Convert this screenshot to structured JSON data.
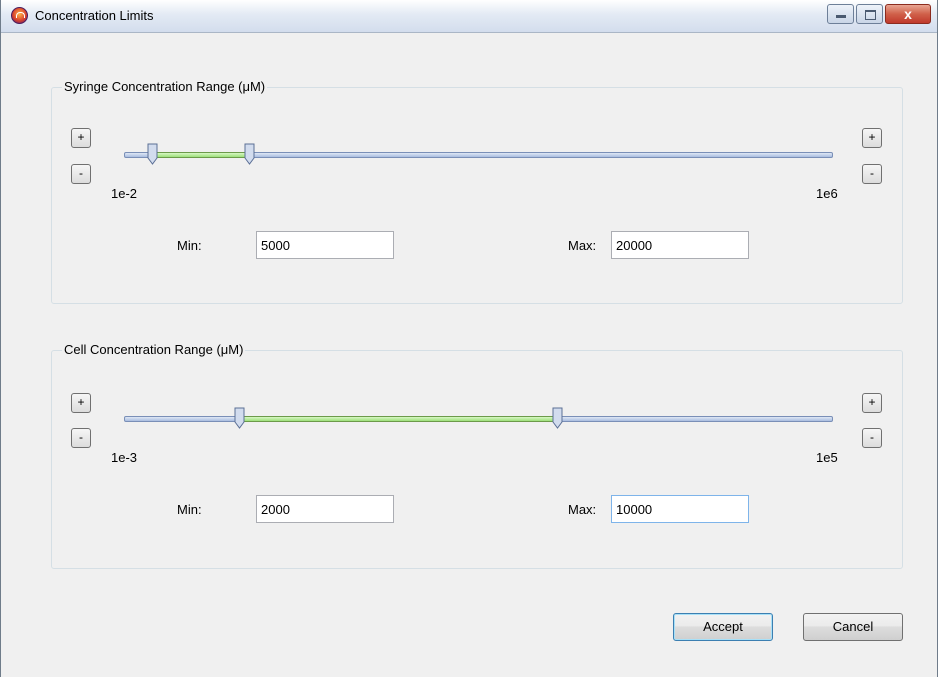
{
  "window": {
    "title": "Concentration Limits",
    "controls": [
      "minimize-icon",
      "maximize-icon",
      "close-icon"
    ],
    "close_glyph": "x"
  },
  "syringe": {
    "title": "Syringe Concentration Range (μM)",
    "increment_label": "+",
    "decrement_label": "-",
    "scale_min": "1e-2",
    "scale_max": "1e6",
    "min_label": "Min:",
    "max_label": "Max:",
    "min_value": "5000",
    "max_value": "20000"
  },
  "cell": {
    "title": "Cell Concentration Range (μM)",
    "increment_label": "+",
    "decrement_label": "-",
    "scale_min": "1e-3",
    "scale_max": "1e5",
    "min_label": "Min:",
    "max_label": "Max:",
    "min_value": "2000",
    "max_value": "10000"
  },
  "buttons": {
    "accept": "Accept",
    "cancel": "Cancel"
  },
  "colors": {
    "range_fill": "#9de07a",
    "track": "#a9bde0"
  }
}
